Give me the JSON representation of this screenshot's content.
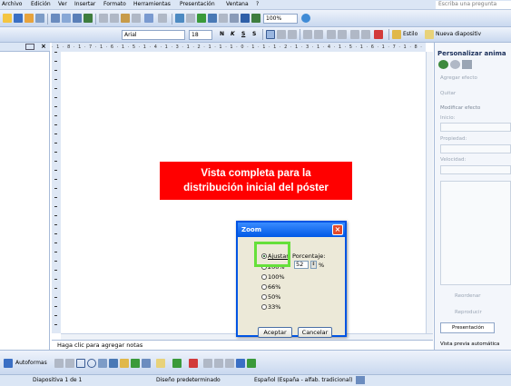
{
  "menu": [
    "Archivo",
    "Edición",
    "Ver",
    "Insertar",
    "Formato",
    "Herramientas",
    "Presentación",
    "Ventana",
    "?"
  ],
  "help_placeholder": "Escriba una pregunta",
  "toolbar": {
    "zoom": "100%",
    "font": "Arial",
    "size": "18",
    "bold": "N",
    "italic": "K",
    "underline": "S",
    "shadow": "S",
    "design_label": "Estilo",
    "new_slide_label": "Nueva diapositiv"
  },
  "ruler_h": "· 1 · 8 · 1 · 7 · 1 · 6 · 1 · 5 · 1 · 4 · 1 · 3 · 1 · 2 · 1 · 1 · 1 · 0 · 1 · 1 · 1 · 2 · 1 · 3 · 1 · 4 · 1 · 5 · 1 · 6 · 1 · 7 · 1 · 8 · 1 ·",
  "banner": {
    "line1": "Vista  completa para la",
    "line2": "distribución inicial del póster"
  },
  "dialog": {
    "title": "Zoom",
    "options": [
      "Ajustar",
      "200%",
      "100%",
      "66%",
      "50%",
      "33%"
    ],
    "percent_label": "Porcentaje:",
    "percent_value": "52",
    "percent_unit": "%",
    "ok": "Aceptar",
    "cancel": "Cancelar"
  },
  "notes_placeholder": "Haga clic para agregar notas",
  "task_pane": {
    "title": "Personalizar anima",
    "add_effect": "Agregar efecto",
    "remove": "Quitar",
    "modify": "Modificar efecto",
    "start": "Inicio:",
    "property": "Propiedad:",
    "speed": "Velocidad:",
    "reorder": "Reordenar",
    "play": "Reproducir",
    "slideshow": "Presentación",
    "autopreview": "Vista previa automática"
  },
  "drawbar": {
    "autoshapes": "Autoformas"
  },
  "status": {
    "slide": "Diapositiva 1 de 1",
    "design": "Diseño predeterminado",
    "language": "Español (España - alfab. tradicional)"
  }
}
